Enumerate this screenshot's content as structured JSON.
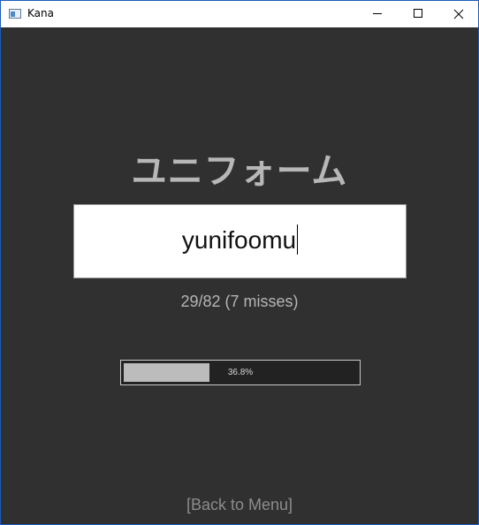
{
  "window": {
    "title": "Kana",
    "icon": "app-window-icon",
    "controls": [
      "minimize-icon",
      "maximize-icon",
      "close-icon"
    ]
  },
  "quiz": {
    "kana": "ユニフォーム",
    "answer_input": "yunifoomu",
    "score_text": "29/82 (7 misses)"
  },
  "progress": {
    "fraction": 0.368,
    "label": "36.8%"
  },
  "footer": {
    "back_label": "[Back to Menu]"
  },
  "colors": {
    "background": "#303030",
    "kana_text": "#b7b7b7",
    "progress_fill": "#bcbcbc",
    "link": "#8c8c8c"
  }
}
